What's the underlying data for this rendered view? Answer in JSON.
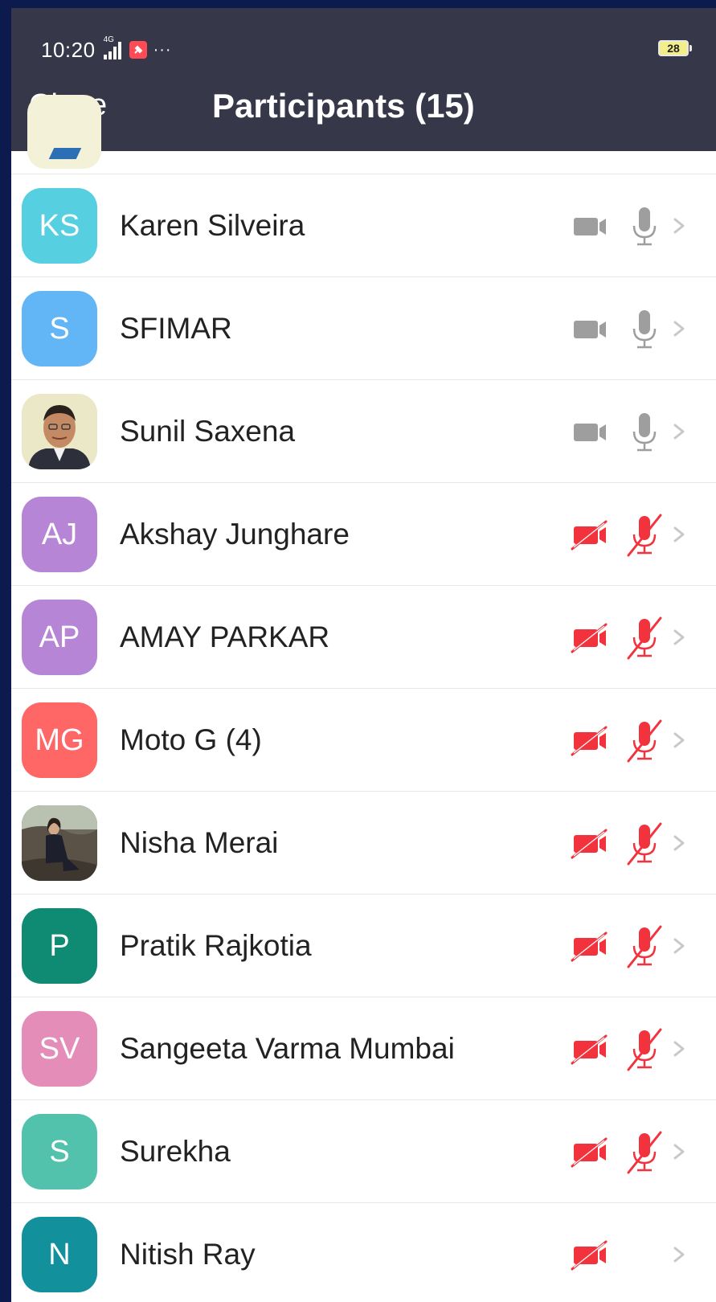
{
  "status_bar": {
    "time": "10:20",
    "network": "4G",
    "battery": "28"
  },
  "header": {
    "close_label": "Close",
    "title": "Participants (15)"
  },
  "colors": {
    "header_bg": "#363749",
    "muted_icon": "#9e9e9e",
    "muted_red": "#f2333d"
  },
  "participants": [
    {
      "initials": "KS",
      "name": "Karen Silveira",
      "avatar_color": "#56d0e0",
      "photo": false,
      "video": "on",
      "audio": "on"
    },
    {
      "initials": "S",
      "name": "SFIMAR",
      "avatar_color": "#63b6f5",
      "photo": false,
      "video": "on",
      "audio": "on"
    },
    {
      "initials": "",
      "name": "Sunil Saxena",
      "avatar_color": "#e9e6c4",
      "photo": true,
      "video": "on",
      "audio": "on"
    },
    {
      "initials": "AJ",
      "name": "Akshay Junghare",
      "avatar_color": "#b785d6",
      "photo": false,
      "video": "off",
      "audio": "off"
    },
    {
      "initials": "AP",
      "name": "AMAY PARKAR",
      "avatar_color": "#b785d6",
      "photo": false,
      "video": "off",
      "audio": "off"
    },
    {
      "initials": "MG",
      "name": "Moto G (4)",
      "avatar_color": "#ff6666",
      "photo": false,
      "video": "off",
      "audio": "off"
    },
    {
      "initials": "",
      "name": "Nisha Merai",
      "avatar_color": "#7a6d5d",
      "photo": true,
      "video": "off",
      "audio": "off"
    },
    {
      "initials": "P",
      "name": "Pratik Rajkotia",
      "avatar_color": "#0f8a73",
      "photo": false,
      "video": "off",
      "audio": "off"
    },
    {
      "initials": "SV",
      "name": "Sangeeta Varma Mumbai",
      "avatar_color": "#e38db8",
      "photo": false,
      "video": "off",
      "audio": "off"
    },
    {
      "initials": "S",
      "name": "Surekha",
      "avatar_color": "#52c2ad",
      "photo": false,
      "video": "off",
      "audio": "off"
    },
    {
      "initials": "N",
      "name": "Nitish Ray",
      "avatar_color": "#12919c",
      "photo": false,
      "video": "off",
      "audio": "none"
    }
  ]
}
